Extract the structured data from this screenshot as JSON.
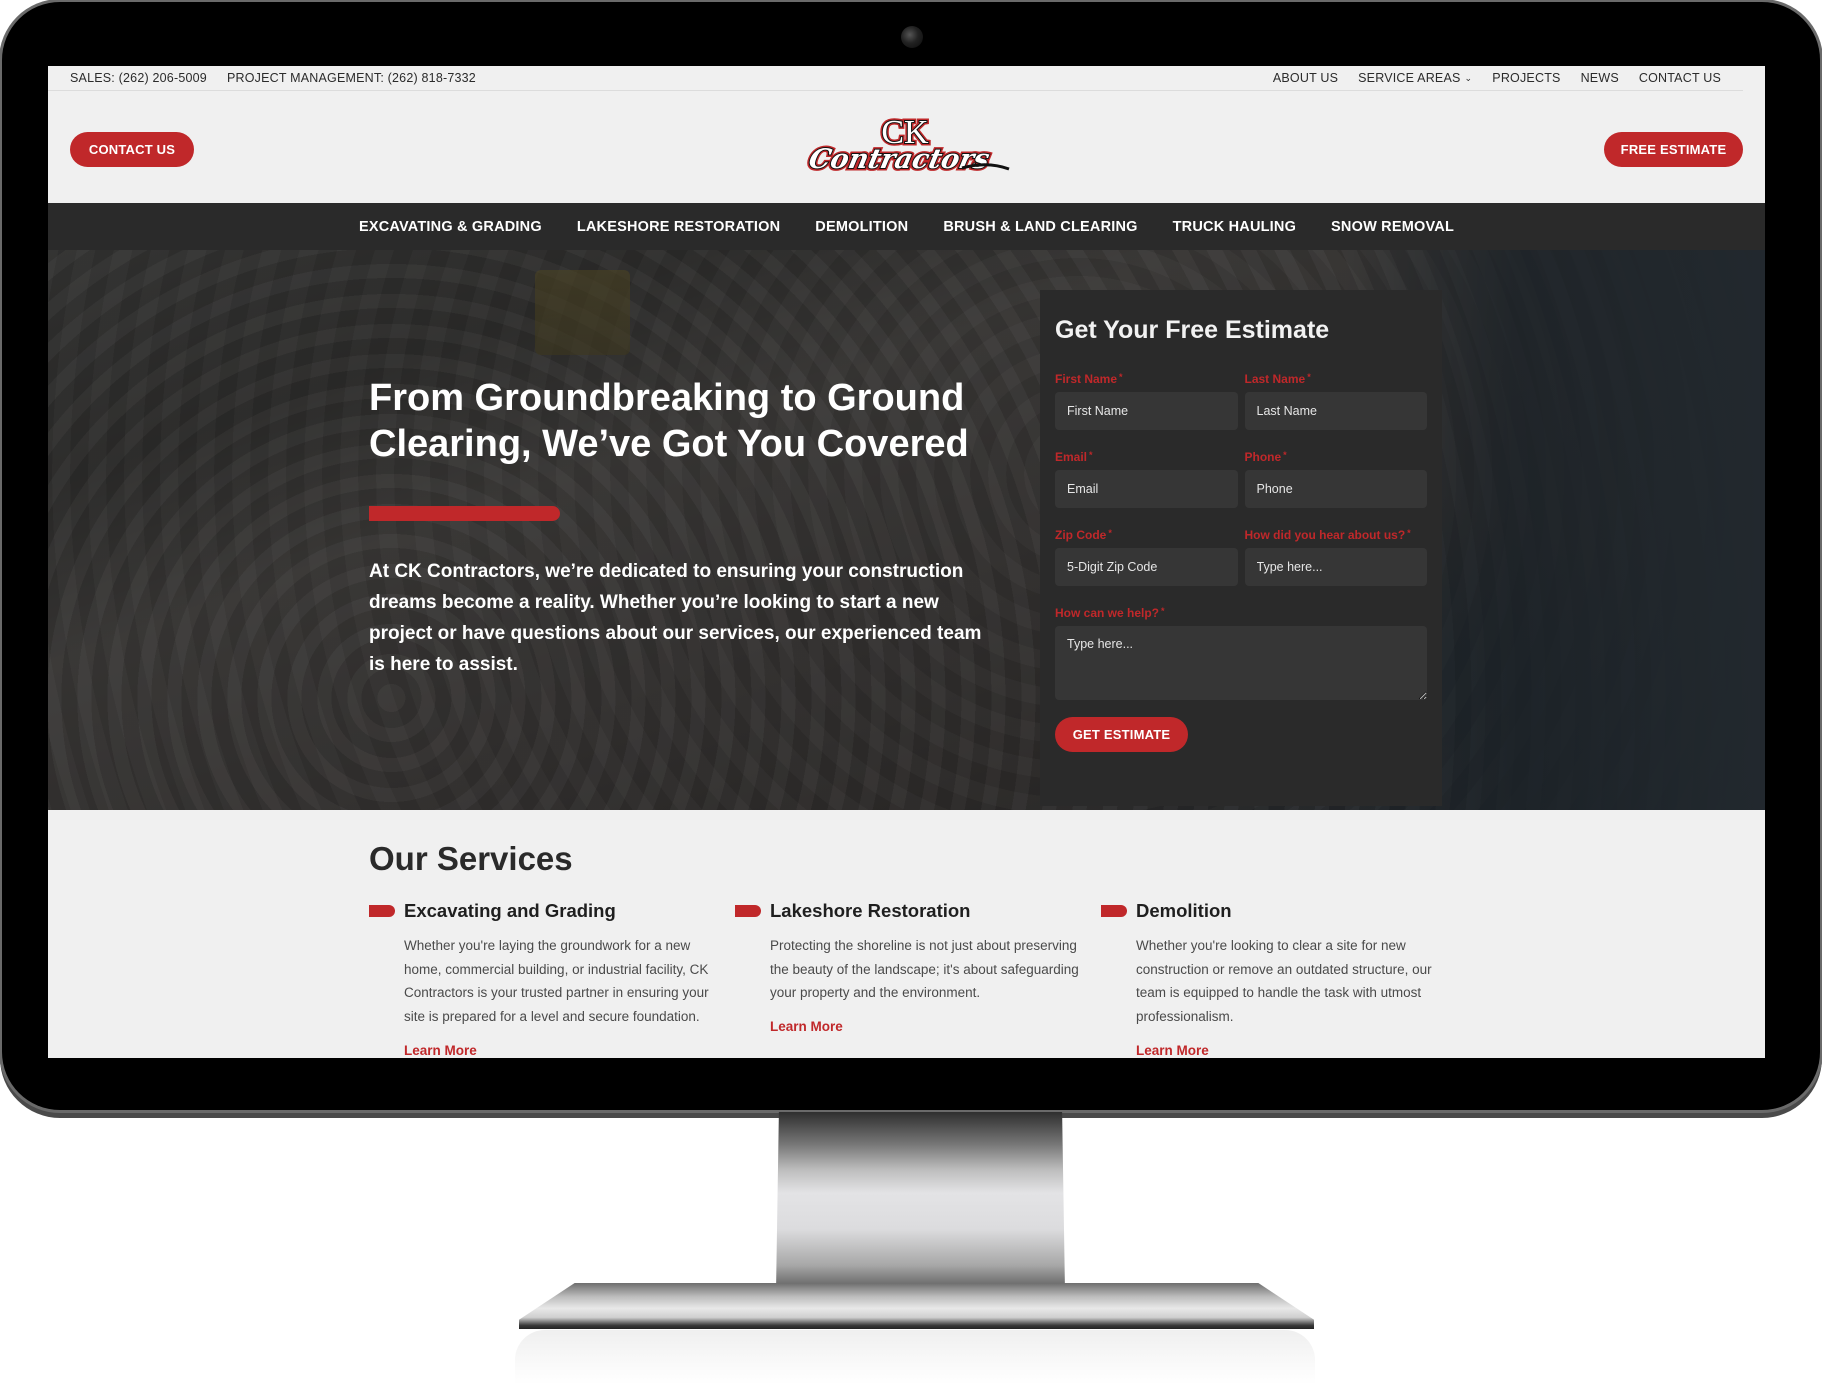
{
  "topbar": {
    "sales": "SALES: (262) 206-5009",
    "project_management": "PROJECT MANAGEMENT: (262) 818-7332",
    "links": [
      {
        "label": "ABOUT US"
      },
      {
        "label": "SERVICE AREAS",
        "has_dropdown": true
      },
      {
        "label": "PROJECTS"
      },
      {
        "label": "NEWS"
      },
      {
        "label": "CONTACT US"
      }
    ],
    "dropdown_icon": "⌄"
  },
  "header": {
    "contact_button": "CONTACT US",
    "estimate_button": "FREE ESTIMATE",
    "logo": {
      "line1": "CK",
      "line2": "Contractors"
    }
  },
  "nav": {
    "items": [
      {
        "label": "EXCAVATING & GRADING"
      },
      {
        "label": "LAKESHORE RESTORATION"
      },
      {
        "label": "DEMOLITION"
      },
      {
        "label": "BRUSH & LAND CLEARING"
      },
      {
        "label": "TRUCK HAULING"
      },
      {
        "label": "SNOW REMOVAL"
      }
    ]
  },
  "hero": {
    "title": "From Groundbreaking to Ground Clearing, We’ve Got You Covered",
    "text": "At CK Contractors, we’re dedicated to ensuring your construction dreams become a reality. Whether you’re looking to start a new project or have questions about our services, our experienced team is here to assist."
  },
  "form": {
    "title": "Get Your Free Estimate",
    "required_mark": "*",
    "fields": {
      "first_name": {
        "label": "First Name",
        "placeholder": "First Name"
      },
      "last_name": {
        "label": "Last Name",
        "placeholder": "Last Name"
      },
      "email": {
        "label": "Email",
        "placeholder": "Email"
      },
      "phone": {
        "label": "Phone",
        "placeholder": "Phone"
      },
      "zip": {
        "label": "Zip Code",
        "placeholder": "5-Digit Zip Code"
      },
      "referral": {
        "label": "How did you hear about us?",
        "placeholder": "Type here..."
      },
      "help": {
        "label": "How can we help?",
        "placeholder": "Type here..."
      }
    },
    "submit": "GET ESTIMATE"
  },
  "services": {
    "title": "Our Services",
    "items": [
      {
        "title": "Excavating and Grading",
        "text": "Whether you're laying the groundwork for a new home, commercial building, or industrial facility, CK Contractors is your trusted partner in ensuring your site is prepared for a level and secure foundation.",
        "link": "Learn More"
      },
      {
        "title": "Lakeshore Restoration",
        "text": "Protecting the shoreline is not just about preserving the beauty of the landscape; it's about safeguarding your property and the environment.",
        "link": "Learn More"
      },
      {
        "title": "Demolition",
        "text": "Whether you're looking to clear a site for new construction or remove an outdated structure, our team is equipped to handle the task with utmost professionalism.",
        "link": "Learn More"
      }
    ]
  },
  "colors": {
    "accent": "#c0282a",
    "nav_bg": "#2a2a2a",
    "page_bg": "#f0f0f0",
    "form_bg": "#2a2a2a",
    "input_bg": "#363636"
  }
}
